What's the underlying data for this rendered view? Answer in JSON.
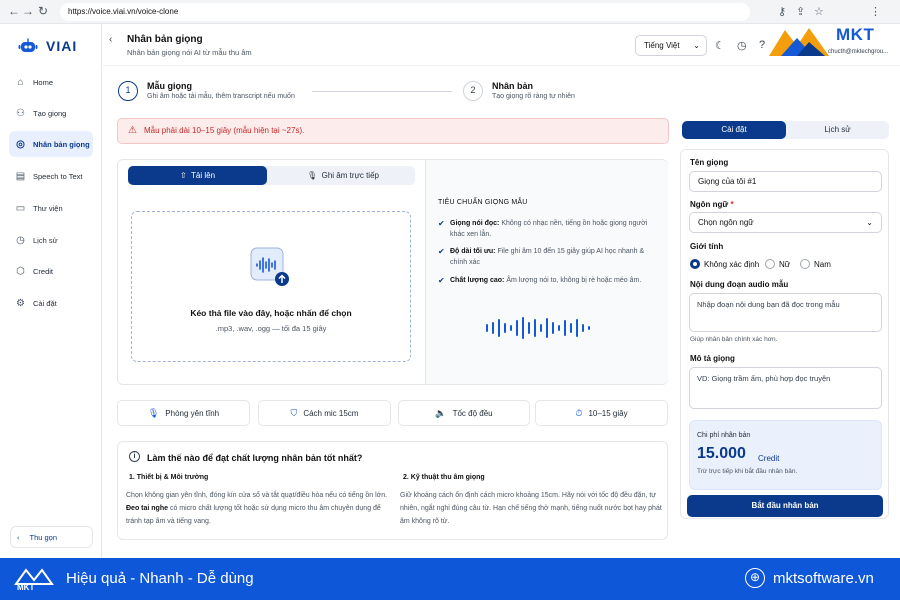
{
  "browser": {
    "url": "https://voice.viai.vn/voice-clone"
  },
  "app": {
    "name": "VIAI"
  },
  "sidebar": {
    "items": [
      {
        "label": "Home",
        "icon": "home-icon"
      },
      {
        "label": "Tạo giọng",
        "icon": "users-icon"
      },
      {
        "label": "Nhân bản giọng",
        "icon": "clone-icon",
        "active": true
      },
      {
        "label": "Speech to Text",
        "icon": "document-icon"
      },
      {
        "label": "Thư viện",
        "icon": "folder-icon"
      },
      {
        "label": "Lịch sử",
        "icon": "history-icon"
      },
      {
        "label": "Credit",
        "icon": "credit-icon"
      },
      {
        "label": "Cài đặt",
        "icon": "gear-icon"
      }
    ],
    "collapse_label": "Thu gọn"
  },
  "header": {
    "title": "Nhân bản giọng",
    "subtitle": "Nhân bản giọng nói AI từ mẫu thu âm",
    "language": "Tiếng Việt",
    "brand": "MKT",
    "email": "chucth@mktechgrou..."
  },
  "steps": [
    {
      "num": "1",
      "title": "Mẫu giọng",
      "sub": "Ghi âm hoặc tải mẫu, thêm transcript nếu muốn"
    },
    {
      "num": "2",
      "title": "Nhân bản",
      "sub": "Tạo giọng rõ ràng tự nhiên"
    }
  ],
  "alert": {
    "text": "Mẫu phải dài 10–15 giây (mẫu hiện tại ~27s)."
  },
  "upload": {
    "tab_upload": "Tải lên",
    "tab_record": "Ghi âm trực tiếp",
    "drop_title": "Kéo thả file vào đây, hoặc nhấn để chọn",
    "drop_sub": ".mp3, .wav, .ogg — tối đa 15 giây"
  },
  "standards": {
    "title": "TIÊU CHUẨN GIỌNG MẪU",
    "items": [
      {
        "bold": "Giọng nói đọc:",
        "text": " Không có nhạc nền, tiếng ồn hoặc giọng người khác xen lẫn."
      },
      {
        "bold": "Độ dài tối ưu:",
        "text": " File ghi âm 10 đến 15 giây giúp AI học nhanh & chính xác"
      },
      {
        "bold": "Chất lượng cao:",
        "text": " Âm lượng nói to, không bị rè hoặc méo âm."
      }
    ]
  },
  "chips": [
    {
      "label": "Phòng yên tĩnh",
      "icon": "mic-icon"
    },
    {
      "label": "Cách mic 15cm",
      "icon": "shield-icon"
    },
    {
      "label": "Tốc độ đều",
      "icon": "speaker-icon"
    },
    {
      "label": "10–15 giây",
      "icon": "timer-icon"
    }
  ],
  "tips": {
    "title": "Làm thế nào để đạt chất lượng nhân bản tốt nhất?",
    "col1_title": "1. Thiết bị & Môi trường",
    "col1_text_a": "Chọn không gian yên tĩnh, đóng kín cửa sổ và tắt quạt/điều hòa nếu có tiếng ồn lớn. ",
    "col1_bold": "Đeo tai nghe",
    "col1_text_b": " có micro chất lượng tốt hoặc sử dụng micro thu âm chuyên dụng để tránh tạp âm và tiếng vang.",
    "col2_title": "2. Kỹ thuật thu âm giọng",
    "col2_text": "Giữ khoảng cách ổn định cách micro khoảng 15cm. Hãy nói với tốc độ đều đặn, tự nhiên, ngắt nghỉ đúng câu từ. Hạn chế tiếng thở mạnh, tiếng nuốt nước bọt hay phát âm không rõ từ."
  },
  "panel": {
    "tab_settings": "Cài đặt",
    "tab_history": "Lịch sử",
    "name_label": "Tên giọng",
    "name_value": "Giọng của tôi #1",
    "lang_label": "Ngôn ngữ",
    "lang_required": "*",
    "lang_placeholder": "Chọn ngôn ngữ",
    "gender_label": "Giới tính",
    "gender_options": [
      "Không xác định",
      "Nữ",
      "Nam"
    ],
    "audio_label": "Nội dung đoạn audio mẫu",
    "audio_placeholder": "Nhập đoạn nội dung bạn đã đọc trong mẫu",
    "audio_hint": "Giúp nhân bản chính xác hơn.",
    "desc_label": "Mô tả giọng",
    "desc_placeholder": "VD: Giọng trầm ấm, phù hợp đọc truyện",
    "cost_label": "Chi phí nhân bản",
    "cost_value": "15.000",
    "cost_unit": "Credit",
    "cost_hint": "Trừ trực tiếp khi bắt đầu nhân bản.",
    "start_button": "Bắt đầu nhân bản"
  },
  "footer": {
    "brand": "MKT",
    "slogan": "Hiệu quả - Nhanh - Dễ dùng",
    "site": "mktsoftware.vn"
  },
  "colors": {
    "primary": "#0b3a8c",
    "accent": "#1559d6",
    "alert": "#c62828",
    "banner": "#0d57d8"
  }
}
